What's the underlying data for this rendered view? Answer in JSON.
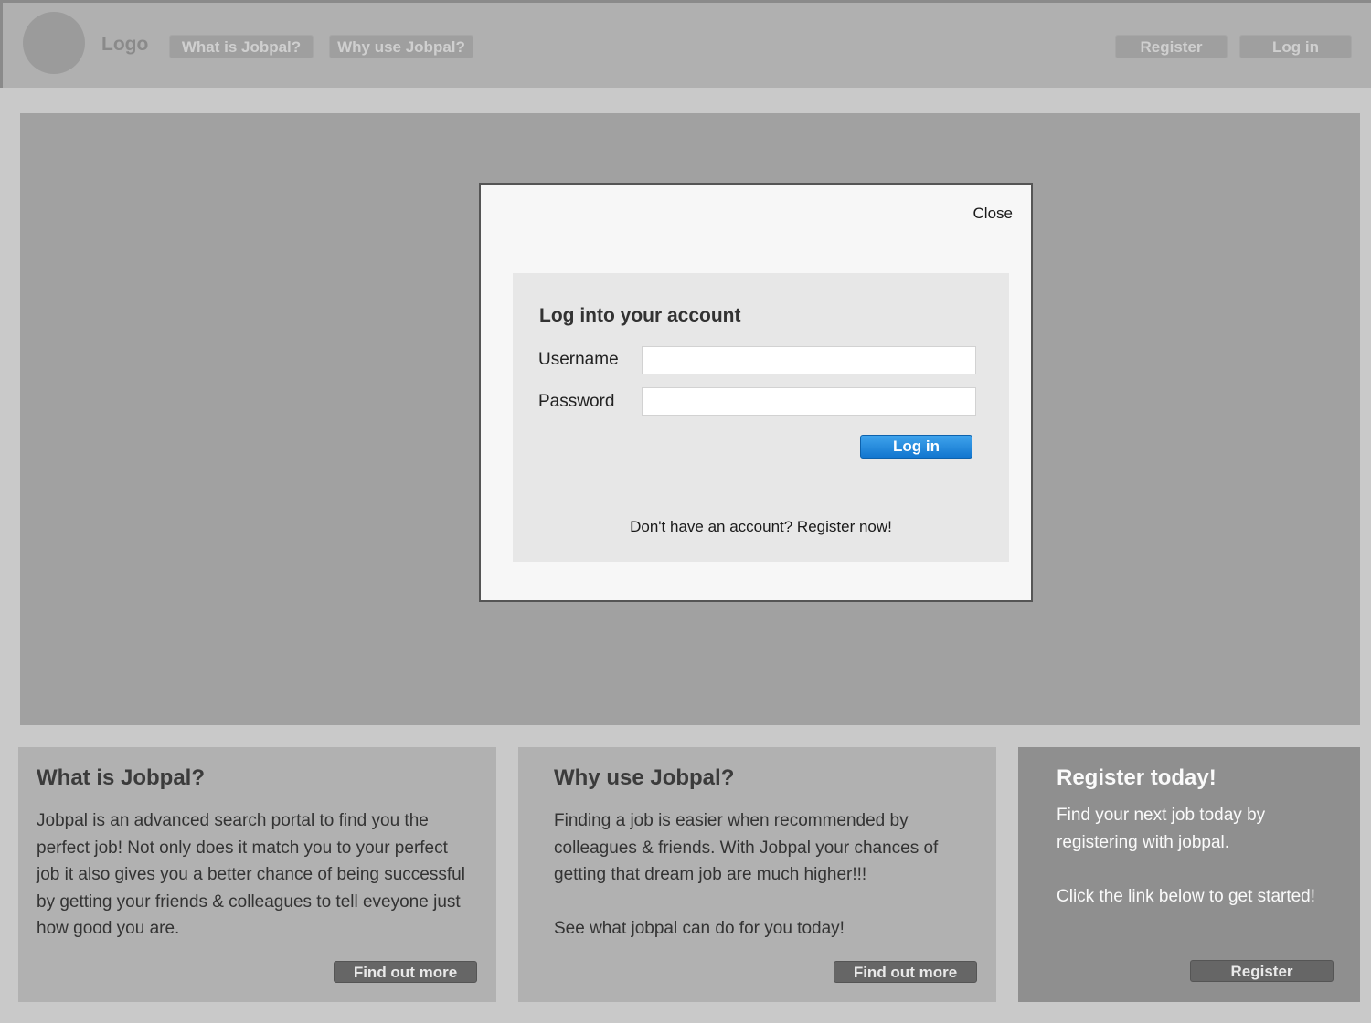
{
  "header": {
    "logo": "Logo",
    "nav": [
      "What is Jobpal?",
      "Why use Jobpal?"
    ],
    "register_label": "Register",
    "login_label": "Log in"
  },
  "modal": {
    "close_label": "Close",
    "title": "Log into your account",
    "username_label": "Username",
    "username_value": "",
    "password_label": "Password",
    "password_value": "",
    "login_button": "Log in",
    "register_prompt": "Don't have an account? Register now!"
  },
  "cards": [
    {
      "title": "What is Jobpal?",
      "paragraphs": [
        "Jobpal is an advanced search portal to find you the perfect job! Not only does it match you to your perfect job it also gives you a better chance of being successful by getting your friends & colleagues to tell eveyone just how good you are."
      ],
      "button": "Find out more"
    },
    {
      "title": "Why use Jobpal?",
      "paragraphs": [
        "Finding a job is easier when recommended by colleagues & friends. With Jobpal your chances of getting that dream job are much higher!!!",
        "See what jobpal can do for you today!"
      ],
      "button": "Find out more"
    },
    {
      "title": "Register today!",
      "paragraphs": [
        "Find your next job today by registering with jobpal.",
        "Click the link below to get started!"
      ],
      "button": "Register"
    }
  ],
  "colors": {
    "accent_button": "#1a82db",
    "dark_button": "#666666",
    "page_background": "#c9c9c9"
  }
}
